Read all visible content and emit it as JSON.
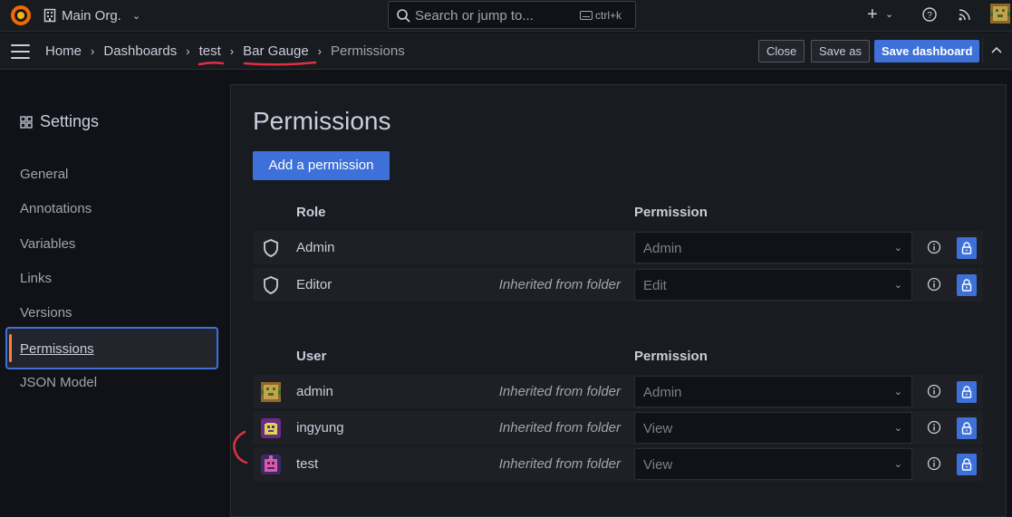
{
  "topbar": {
    "org_name": "Main Org.",
    "search_placeholder": "Search or jump to...",
    "search_shortcut": "ctrl+k"
  },
  "navbar": {
    "breadcrumbs": [
      "Home",
      "Dashboards",
      "test",
      "Bar Gauge",
      "Permissions"
    ],
    "close_label": "Close",
    "save_as_label": "Save as",
    "save_dashboard_label": "Save dashboard"
  },
  "settings": {
    "title": "Settings",
    "items": [
      "General",
      "Annotations",
      "Variables",
      "Links",
      "Versions",
      "Permissions",
      "JSON Model"
    ],
    "active_item": "Permissions"
  },
  "main": {
    "title": "Permissions",
    "add_button": "Add a permission",
    "role_table": {
      "headers": [
        "Role",
        "Permission"
      ],
      "rows": [
        {
          "name": "Admin",
          "inherited": "",
          "permission": "Admin"
        },
        {
          "name": "Editor",
          "inherited": "Inherited from folder",
          "permission": "Edit"
        }
      ]
    },
    "user_table": {
      "headers": [
        "User",
        "Permission"
      ],
      "rows": [
        {
          "name": "admin",
          "inherited": "Inherited from folder",
          "permission": "Admin"
        },
        {
          "name": "ingyung",
          "inherited": "Inherited from folder",
          "permission": "View"
        },
        {
          "name": "test",
          "inherited": "Inherited from folder",
          "permission": "View"
        }
      ]
    }
  },
  "colors": {
    "accent": "#3d71d9",
    "active_marker": "#ff7f3f",
    "annotation": "#e02f44"
  }
}
